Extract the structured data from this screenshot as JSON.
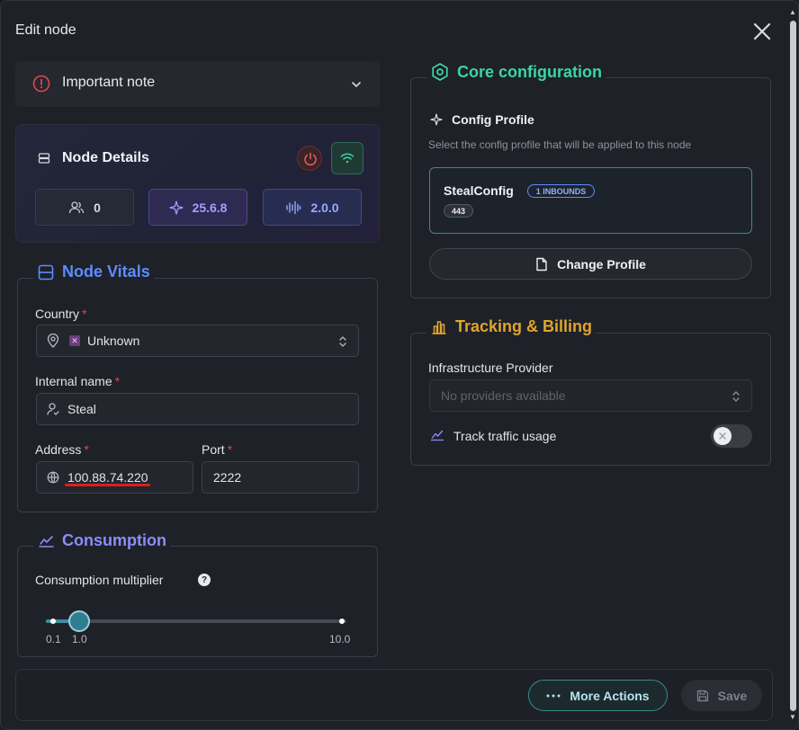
{
  "modal": {
    "title": "Edit node"
  },
  "note": {
    "label": "Important note"
  },
  "details": {
    "title": "Node Details",
    "stats": {
      "users": "0",
      "xray_version": "25.6.8",
      "node_version": "2.0.0"
    }
  },
  "vitals": {
    "legend": "Node Vitals",
    "country": {
      "label": "Country",
      "required": "*",
      "value": "Unknown"
    },
    "internal_name": {
      "label": "Internal name",
      "required": "*",
      "value": "Steal"
    },
    "address": {
      "label": "Address",
      "required": "*",
      "value": "100.88.74.220"
    },
    "port": {
      "label": "Port",
      "required": "*",
      "value": "2222"
    }
  },
  "consumption": {
    "legend": "Consumption",
    "multiplier_label": "Consumption multiplier",
    "help": "?",
    "slider": {
      "min_label": "0.1",
      "value_label": "1.0",
      "max_label": "10.0",
      "min": 0.1,
      "max": 10.0,
      "value": 1.0
    }
  },
  "core": {
    "legend": "Core configuration",
    "profile_label": "Config Profile",
    "profile_hint": "Select the config profile that will be applied to this node",
    "profile_name": "StealConfig",
    "inbounds_badge": "1 INBOUNDS",
    "port_badge": "443",
    "change_button": "Change Profile"
  },
  "tracking": {
    "legend": "Tracking & Billing",
    "provider_label": "Infrastructure Provider",
    "provider_placeholder": "No providers available",
    "traffic_label": "Track traffic usage",
    "traffic_enabled": false
  },
  "footer": {
    "more_actions": "More Actions",
    "save": "Save"
  },
  "colors": {
    "accent_teal": "#3dd4a7",
    "accent_blue": "#5c8cff",
    "accent_purple": "#8c8cff",
    "accent_gold": "#e0a52c",
    "required_red": "#e0464c",
    "underline_red": "#e01c1c"
  },
  "icons": {
    "close": "close-icon",
    "note": "info-circle-icon",
    "chevron": "chevron-down-icon",
    "details": "server-icon",
    "power": "power-icon",
    "wifi": "wifi-icon",
    "users": "users-icon",
    "xray": "sparkle-icon",
    "node": "signal-icon",
    "vitals": "server-stack-icon",
    "location": "map-pin-icon",
    "user": "user-check-icon",
    "globe": "globe-icon",
    "consumption": "chart-line-icon",
    "core": "hexagon-gear-icon",
    "profile": "sparkle-icon",
    "file": "file-icon",
    "tracking": "bar-chart-icon",
    "traffic": "chart-line-icon",
    "more": "dots-icon",
    "save": "floppy-icon"
  }
}
